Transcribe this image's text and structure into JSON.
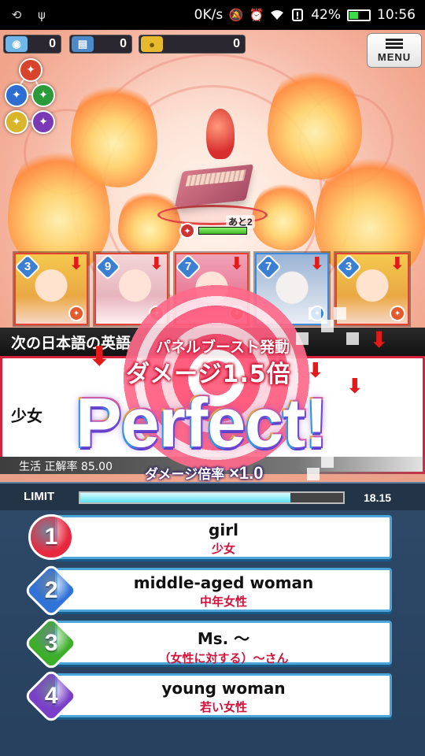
{
  "status_bar": {
    "network_speed": "0K/s",
    "battery_percent": "42%",
    "battery_level": 0.42,
    "time": "10:56",
    "icons": [
      "screen-rotate-icon",
      "usb-icon",
      "mute-icon",
      "alarm-icon",
      "wifi-icon",
      "sim-alert-icon",
      "battery-icon"
    ]
  },
  "resources": [
    {
      "name": "stamina-icon",
      "value": "0"
    },
    {
      "name": "ticket-icon",
      "value": "0"
    },
    {
      "name": "coin-icon",
      "value": "0"
    }
  ],
  "menu": {
    "label": "MENU"
  },
  "enemy": {
    "turns": "あと2",
    "hp_fraction": 1.0
  },
  "party": [
    {
      "level": "3",
      "element": "fire",
      "color": "#e45a2a"
    },
    {
      "level": "9",
      "element": "fire",
      "color": "#e45a2a"
    },
    {
      "level": "7",
      "element": "fire",
      "color": "#e45a2a"
    },
    {
      "level": "7",
      "element": "water",
      "color": "#3a84d6"
    },
    {
      "level": "3",
      "element": "fire",
      "color": "#e45a2a"
    }
  ],
  "question": {
    "prompt": "次の日本語の英語",
    "word": "少女",
    "category": "生活",
    "accuracy_label": "正解率",
    "accuracy": "85.00"
  },
  "effect": {
    "boost_title": "パネルブースト発動",
    "boost_damage": "ダメージ1.5倍",
    "result": "Perfect!",
    "damage_rate_label": "ダメージ倍率",
    "damage_rate_value": "×1.0"
  },
  "limit": {
    "label": "LIMIT",
    "time": "18.15",
    "remaining_fraction": 0.8
  },
  "answers": [
    {
      "number": "1",
      "english": "girl",
      "japanese": "少女",
      "color": "#e8283f",
      "shape": "circle"
    },
    {
      "number": "2",
      "english": "middle-aged woman",
      "japanese": "中年女性",
      "color": "#2f72d8",
      "shape": "diamond"
    },
    {
      "number": "3",
      "english": "Ms. ～",
      "japanese": "（女性に対する）～さん",
      "color": "#3cae2a",
      "shape": "diamond"
    },
    {
      "number": "4",
      "english": "young woman",
      "japanese": "若い女性",
      "color": "#7a3fc8",
      "shape": "diamond"
    }
  ]
}
